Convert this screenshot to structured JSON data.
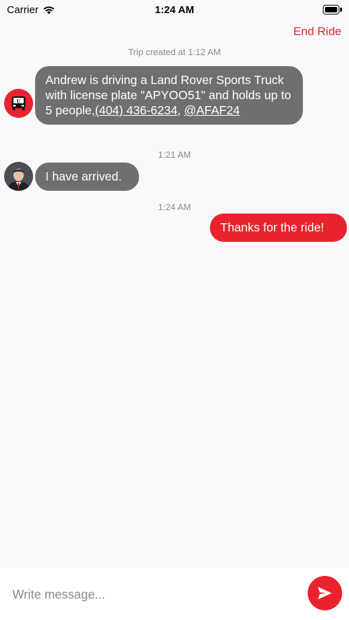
{
  "status_bar": {
    "carrier": "Carrier",
    "time": "1:24 AM"
  },
  "header": {
    "end_ride_label": "End Ride"
  },
  "conversation": {
    "trip_created": "Trip created at 1:12 AM",
    "messages": [
      {
        "sender": "bot",
        "avatar_icon": "bus-logo-icon",
        "text_part1": "Andrew is driving a Land Rover Sports Truck with license plate \"APYOO51\" and holds up to 5 people,",
        "phone_link": "(404) 436-6234",
        "text_part2": ", ",
        "handle_link": "@AFAF24"
      },
      {
        "timestamp": "1:21 AM",
        "sender": "driver",
        "avatar_icon": "driver-avatar-icon",
        "text": "I have arrived."
      },
      {
        "timestamp": "1:24 AM",
        "sender": "me",
        "text": "Thanks for the ride!"
      }
    ]
  },
  "composer": {
    "placeholder": "Write message...",
    "send_icon": "send-icon"
  },
  "colors": {
    "accent": "#e8232d",
    "incoming_bubble": "#6f6f6f",
    "background": "#f9f9f9"
  }
}
